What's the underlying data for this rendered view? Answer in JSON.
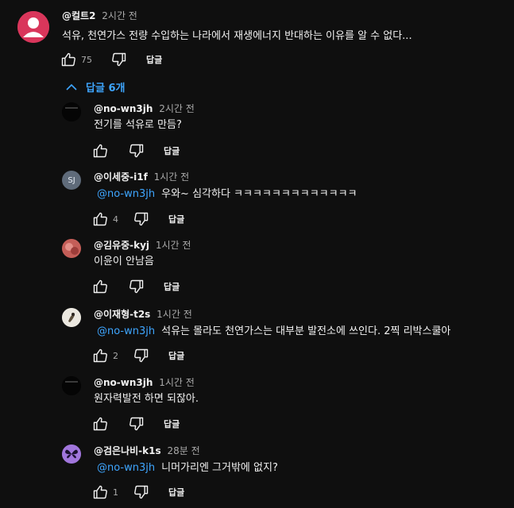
{
  "top_comment": {
    "author": "@컬트2",
    "time": "2시간 전",
    "text": "석유, 천연가스  전량 수입하는 나라에서  재생에너지  반대하는 이유를 알 수 없다...",
    "likes": "75",
    "reply_label": "답글",
    "avatar_color": "#d9365b"
  },
  "replies_toggle": {
    "label": "답글 6개",
    "icon": "chevron-up-icon",
    "color": "#3ea6ff"
  },
  "replies": [
    {
      "author": "@no-wn3jh",
      "time": "2시간 전",
      "mention": "",
      "text": "전기를 석유로 만듬?",
      "likes": "",
      "reply_label": "답글",
      "avatar_initials": ""
    },
    {
      "author": "@이세중-i1f",
      "time": "1시간 전",
      "mention": "@no-wn3jh",
      "text": "우와~ 심각하다 ㅋㅋㅋㅋㅋㅋㅋㅋㅋㅋㅋㅋㅋ",
      "likes": "4",
      "reply_label": "답글",
      "avatar_initials": "SJ"
    },
    {
      "author": "@김유중-kyj",
      "time": "1시간 전",
      "mention": "",
      "text": "이윤이 안남음",
      "likes": "",
      "reply_label": "답글",
      "avatar_initials": ""
    },
    {
      "author": "@이재형-t2s",
      "time": "1시간 전",
      "mention": "@no-wn3jh",
      "text": "석유는 몰라도 천연가스는 대부분  발전소에 쓰인다. 2찍  리박스쿨아",
      "likes": "2",
      "reply_label": "답글",
      "avatar_initials": ""
    },
    {
      "author": "@no-wn3jh",
      "time": "1시간 전",
      "mention": "",
      "text": "원자력발전 하면 되잖아.",
      "likes": "",
      "reply_label": "답글",
      "avatar_initials": ""
    },
    {
      "author": "@검은나비-k1s",
      "time": "28분 전",
      "mention": "@no-wn3jh",
      "text": "니머가리엔  그거밖에 없지?",
      "likes": "1",
      "reply_label": "답글",
      "avatar_initials": ""
    }
  ]
}
